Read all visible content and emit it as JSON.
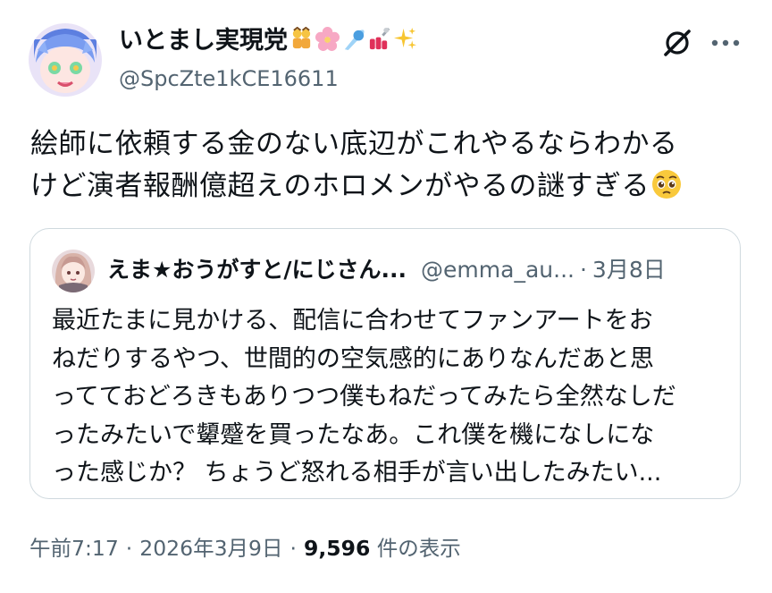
{
  "author": {
    "display_name": "いとまし実現党",
    "name_emojis": [
      "twins-icon",
      "cherry-blossom-icon",
      "comet-icon",
      "nail-polish-icon",
      "sparkles-icon"
    ],
    "handle": "@SpcZte1kCE16611"
  },
  "actions": {
    "grok_icon": "grok-icon",
    "more_label": "···"
  },
  "tweet": {
    "lines": [
      "絵師に依頼する金のない底辺がこれやるならわかる",
      "けど演者報酬億超えのホロメンがやるの謎すぎる"
    ],
    "trailing_emoji": "pleading-face-icon"
  },
  "quote": {
    "display_name": "えま★おうがすと/にじさん...",
    "handle": "@emma_au...",
    "separator": "·",
    "date": "3月8日",
    "lines": [
      "最近たまに見かける、配信に合わせてファンアートをお",
      "ねだりするやつ、世間的の空気感的にありなんだあと思",
      "ってておどろきもありつつ僕もねだってみたら全然なしだ",
      "ったみたいで顰蹙を買ったなあ。これ僕を機になしにな",
      "った感じか？ ちょうど怒れる相手が言い出したみたい..."
    ]
  },
  "meta": {
    "time": "午前7:17",
    "separator": "·",
    "date": "2026年3月9日",
    "views_count": "9,596",
    "views_label": "件の表示"
  },
  "colors": {
    "text_primary": "#0f1419",
    "text_secondary": "#536471",
    "border": "#cfd9de"
  }
}
